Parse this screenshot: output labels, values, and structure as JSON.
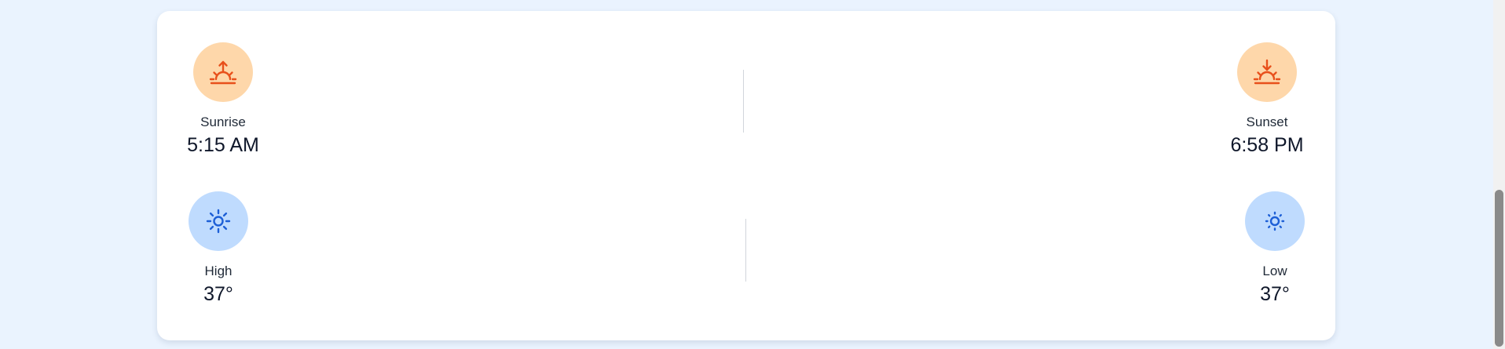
{
  "sunrise": {
    "label": "Sunrise",
    "value": "5:15 AM",
    "icon": "sunrise-icon"
  },
  "sunset": {
    "label": "Sunset",
    "value": "6:58 PM",
    "icon": "sunset-icon"
  },
  "high": {
    "label": "High",
    "value": "37°",
    "icon": "sun-icon"
  },
  "low": {
    "label": "Low",
    "value": "37°",
    "icon": "sun-dim-icon"
  },
  "colors": {
    "page_bg": "#eaf3fe",
    "orange_circle": "#fed7aa",
    "orange_icon": "#e8501b",
    "blue_circle": "#bfdbfe",
    "blue_icon": "#1d5fd6"
  }
}
